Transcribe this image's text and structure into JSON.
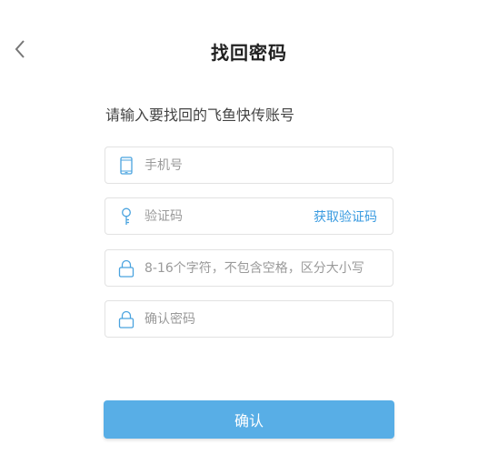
{
  "header": {
    "title": "找回密码"
  },
  "prompt": "请输入要找回的飞鱼快传账号",
  "fields": {
    "phone": {
      "placeholder": "手机号",
      "value": "",
      "icon": "phone-icon"
    },
    "code": {
      "placeholder": "验证码",
      "value": "",
      "icon": "key-icon",
      "action_label": "获取验证码"
    },
    "password": {
      "placeholder": "8-16个字符，不包含空格，区分大小写",
      "value": "",
      "icon": "lock-icon"
    },
    "confirm_password": {
      "placeholder": "确认密码",
      "value": "",
      "icon": "lock-icon"
    }
  },
  "confirm_button": {
    "label": "确认"
  },
  "colors": {
    "accent": "#58aee6",
    "link": "#3a9be0",
    "icon": "#4aa3df",
    "border": "#e2e2e2"
  }
}
